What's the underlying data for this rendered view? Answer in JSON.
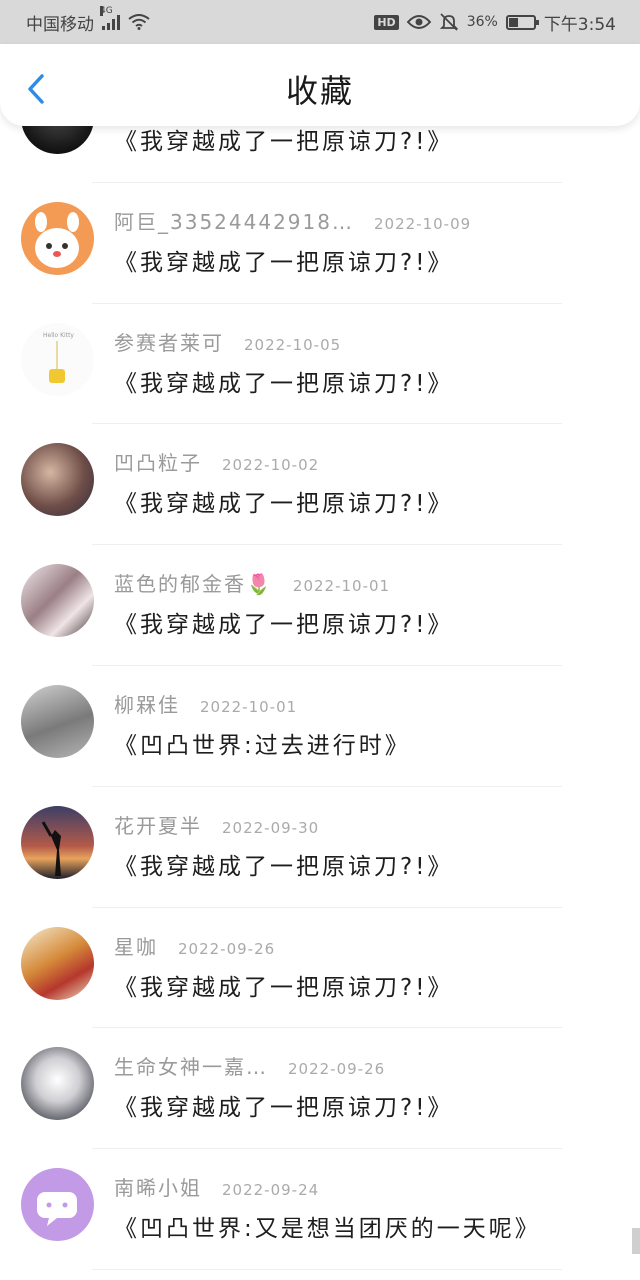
{
  "status_bar": {
    "carrier": "中国移动",
    "network": "4G",
    "battery_pct": "36%",
    "battery_level": 0.36,
    "time": "下午3:54",
    "icons": [
      "signal-icon",
      "wifi-icon",
      "hd-icon",
      "eye-icon",
      "bell-off-icon",
      "battery-icon"
    ]
  },
  "header": {
    "title": "收藏",
    "back_icon": "chevron-left-icon",
    "accent": "#2e8ce6"
  },
  "items": [
    {
      "name": "",
      "date": "",
      "work": "《我穿越成了一把原谅刀?!》"
    },
    {
      "name": "阿巨_33524442918…",
      "date": "2022-10-09",
      "work": "《我穿越成了一把原谅刀?!》"
    },
    {
      "name": "参赛者莱可",
      "date": "2022-10-05",
      "work": "《我穿越成了一把原谅刀?!》"
    },
    {
      "name": "凹凸粒子",
      "date": "2022-10-02",
      "work": "《我穿越成了一把原谅刀?!》"
    },
    {
      "name": "蓝色的郁金香🌷",
      "date": "2022-10-01",
      "work": "《我穿越成了一把原谅刀?!》"
    },
    {
      "name": "柳槑佳",
      "date": "2022-10-01",
      "work": "《凹凸世界:过去进行时》"
    },
    {
      "name": "花开夏半",
      "date": "2022-09-30",
      "work": "《我穿越成了一把原谅刀?!》"
    },
    {
      "name": "星咖",
      "date": "2022-09-26",
      "work": "《我穿越成了一把原谅刀?!》"
    },
    {
      "name": "生命女神一嘉…",
      "date": "2022-09-26",
      "work": "《我穿越成了一把原谅刀?!》"
    },
    {
      "name": "南晞小姐",
      "date": "2022-09-24",
      "work": "《凹凸世界:又是想当团厌的一天呢》"
    }
  ]
}
